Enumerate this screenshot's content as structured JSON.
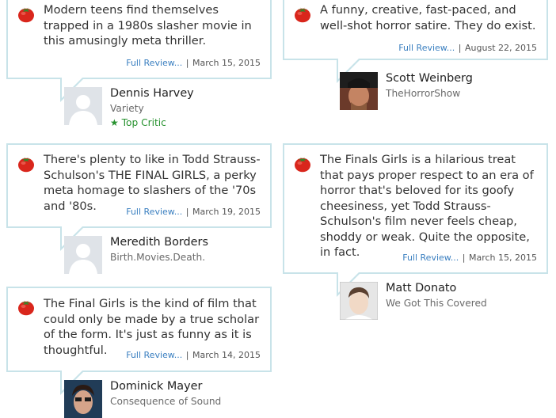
{
  "reviews": [
    {
      "quote": "Modern teens find themselves trapped in a 1980s slasher movie in this amusingly meta thriller.",
      "link": "Full Review...",
      "sep": "|",
      "date": "March 15, 2015",
      "critic": "Dennis Harvey",
      "publication": "Variety",
      "top_critic": "Top Critic",
      "avatar": "placeholder"
    },
    {
      "quote": "A funny, creative, fast-paced, and well-shot horror satire. They do exist.",
      "link": "Full Review...",
      "sep": "|",
      "date": "August 22, 2015",
      "critic": "Scott Weinberg",
      "publication": "TheHorrorShow",
      "avatar": "photo"
    },
    {
      "quote": "There's plenty to like in Todd Strauss-Schulson's THE FINAL GIRLS, a perky meta homage to slashers of the '70s and '80s.",
      "link": "Full Review...",
      "sep": "|",
      "date": "March 19, 2015",
      "critic": "Meredith Borders",
      "publication": "Birth.Movies.Death.",
      "avatar": "placeholder"
    },
    {
      "quote": "The Finals Girls is a hilarious treat that pays proper respect to an era of horror that's beloved for its goofy cheesiness, yet Todd Strauss-Schulson's film never feels cheap, shoddy or weak. Quite the opposite, in fact.",
      "link": "Full Review...",
      "sep": "|",
      "date": "March 15, 2015",
      "critic": "Matt Donato",
      "publication": "We Got This Covered",
      "avatar": "photo"
    },
    {
      "quote": "The Final Girls is the kind of film that could only be made by a true scholar of the form. It's just as funny as it is thoughtful.",
      "link": "Full Review...",
      "sep": "|",
      "date": "March 14, 2015",
      "critic": "Dominick Mayer",
      "publication": "Consequence of Sound",
      "avatar": "photo"
    }
  ],
  "icons": {
    "fresh": "fresh-tomato-icon",
    "top_critic": "star-icon"
  },
  "colors": {
    "card_border": "#c8e3e9",
    "link": "#3a7fc0",
    "top_critic": "#27922f",
    "tomato": "#d9261c"
  }
}
